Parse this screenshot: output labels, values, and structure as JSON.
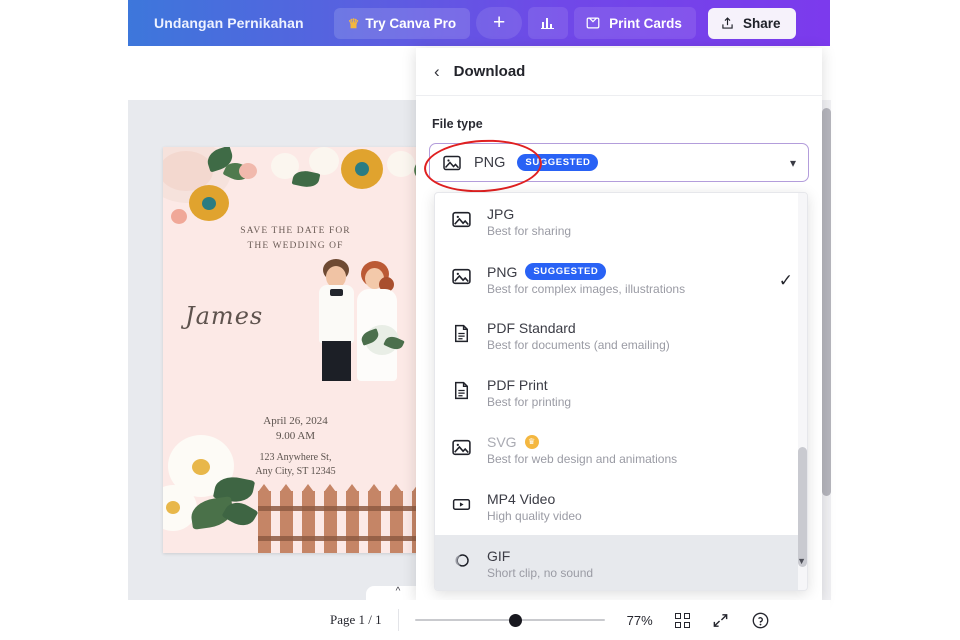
{
  "topbar": {
    "design_title": "Undangan Pernikahan",
    "pro_label": "Try Canva Pro",
    "crown_icon": "crown-icon",
    "add_icon": "plus-icon",
    "chart_icon": "bar-chart-icon",
    "print_label": "Print Cards",
    "print_icon": "envelope-icon",
    "share_label": "Share",
    "share_icon": "upload-icon"
  },
  "card": {
    "save_date_line1": "SAVE THE DATE FOR",
    "save_date_line2": "THE WEDDING OF",
    "names": "James",
    "date": "April 26, 2024",
    "time": "9.00 AM",
    "address_line1": "123 Anywhere St,",
    "address_line2": "Any City, ST 12345"
  },
  "panel": {
    "back_icon": "chevron-left-icon",
    "title": "Download",
    "file_type_label": "File type",
    "selected": {
      "label": "PNG",
      "badge": "SUGGESTED",
      "icon": "image-icon",
      "caret_icon": "chevron-down-icon"
    },
    "options": [
      {
        "label": "JPG",
        "desc": "Best for sharing",
        "icon": "image-icon",
        "badge": "",
        "pro": false,
        "checked": false,
        "hover": false
      },
      {
        "label": "PNG",
        "desc": "Best for complex images, illustrations",
        "icon": "image-icon",
        "badge": "SUGGESTED",
        "pro": false,
        "checked": true,
        "hover": false
      },
      {
        "label": "PDF Standard",
        "desc": "Best for documents (and emailing)",
        "icon": "document-icon",
        "badge": "",
        "pro": false,
        "checked": false,
        "hover": false
      },
      {
        "label": "PDF Print",
        "desc": "Best for printing",
        "icon": "document-icon",
        "badge": "",
        "pro": false,
        "checked": false,
        "hover": false
      },
      {
        "label": "SVG",
        "desc": "Best for web design and animations",
        "icon": "image-icon",
        "badge": "",
        "pro": true,
        "checked": false,
        "hover": false
      },
      {
        "label": "MP4 Video",
        "desc": "High quality video",
        "icon": "video-icon",
        "badge": "",
        "pro": false,
        "checked": false,
        "hover": false
      },
      {
        "label": "GIF",
        "desc": "Short clip, no sound",
        "icon": "gif-icon",
        "badge": "",
        "pro": false,
        "checked": false,
        "hover": true
      }
    ]
  },
  "bottombar": {
    "page_label": "Page 1 / 1",
    "zoom_label": "77%",
    "grid_icon": "grid-view-icon",
    "expand_icon": "fullscreen-icon",
    "help_icon": "help-icon",
    "collapse_icon": "chevron-up-icon"
  },
  "colors": {
    "brand_purple": "#7c3aed",
    "brand_blue": "#3d77db",
    "badge_blue": "#2962f5",
    "annotation_red": "#e02020",
    "card_bg": "#fce9e6",
    "canvas_bg": "#e8eaee"
  }
}
